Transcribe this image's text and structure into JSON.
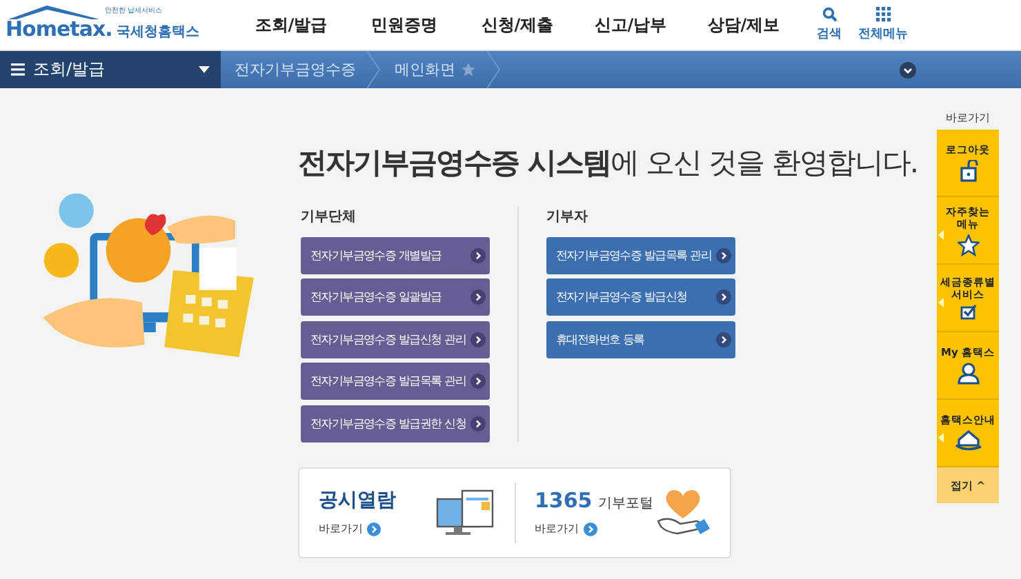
{
  "logo": {
    "slogan": "안전한 납세서비스",
    "name": "Hometax.",
    "agency": "국세청홈택스"
  },
  "top_menu": [
    {
      "label": "조회/발급"
    },
    {
      "label": "민원증명"
    },
    {
      "label": "신청/제출"
    },
    {
      "label": "신고/납부"
    },
    {
      "label": "상담/제보"
    }
  ],
  "top_tools": [
    {
      "kind": "search",
      "label": "검색"
    },
    {
      "kind": "grid",
      "label": "전체메뉴"
    }
  ],
  "breadcrumb": {
    "menu": "조회/발급",
    "items": [
      "전자기부금영수증",
      "메인화면"
    ],
    "favorite": false
  },
  "headline": "**전자기부금영수증 시스템**에 오신 것을 환영합니다.",
  "groups": [
    {
      "title": "기부단체",
      "color": "#645e92",
      "buttons": [
        "전자기부금영수증 개별발급",
        "전자기부금영수증 일괄발급",
        "전자기부금영수증 발급신청 관리",
        "전자기부금영수증 발급목록 관리",
        "전자기부금영수증 발급권한 신청"
      ]
    },
    {
      "title": "기부자",
      "color": "#3b6fb0",
      "buttons": [
        "전자기부금영수증 발급목록 관리",
        "전자기부금영수증 발급신청",
        "휴대전화번호 등록"
      ]
    }
  ],
  "banners": [
    {
      "kind": "disclosure",
      "title": "공시열람",
      "link": "바로가기"
    },
    {
      "kind": "portal",
      "number": "1365",
      "title": "기부포털",
      "link": "바로가기"
    }
  ],
  "quick_links": {
    "title": "바로가기",
    "items": [
      {
        "kind": "lock",
        "label": "로그아웃",
        "flyout": false
      },
      {
        "kind": "star",
        "label": "자주찾는 메뉴",
        "flyout": true
      },
      {
        "kind": "check",
        "label": "세금종류별 서비스",
        "flyout": true
      },
      {
        "kind": "person",
        "label": "My 홈택스",
        "flyout": false
      },
      {
        "kind": "house",
        "label": "홈택스안내",
        "flyout": true
      }
    ],
    "collapse": "접기 ^"
  }
}
